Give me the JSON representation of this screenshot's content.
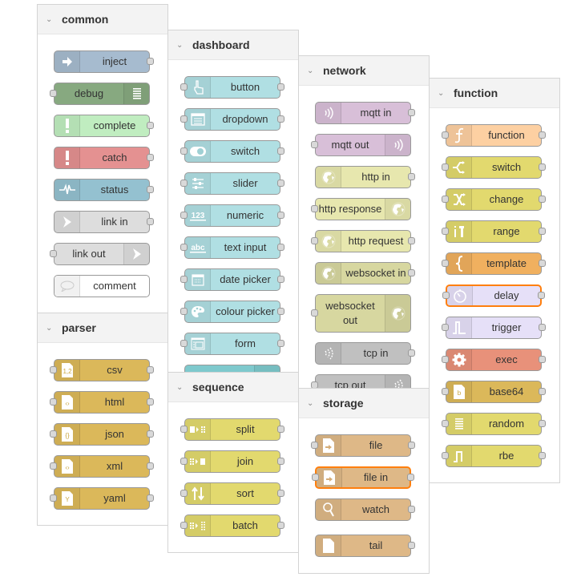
{
  "panels": [
    {
      "title": "common",
      "nodes": [
        {
          "label": "inject",
          "icon": "arrow-in-icon",
          "color": "#a6bbcf",
          "in": false,
          "out": true
        },
        {
          "label": "debug",
          "icon": "list-icon",
          "color": "#87a980",
          "in": true,
          "out": false,
          "icon_right": true
        },
        {
          "label": "complete",
          "icon": "exclamation-icon",
          "color": "#c0edc0",
          "in": false,
          "out": true
        },
        {
          "label": "catch",
          "icon": "exclamation-icon",
          "color": "#e49191",
          "in": false,
          "out": true
        },
        {
          "label": "status",
          "icon": "pulse-icon",
          "color": "#94c1d0",
          "in": false,
          "out": true
        },
        {
          "label": "link in",
          "icon": "link-icon",
          "color": "#dddddd",
          "in": false,
          "out": true
        },
        {
          "label": "link out",
          "icon": "link-icon",
          "color": "#dddddd",
          "in": true,
          "out": false,
          "icon_right": true
        },
        {
          "label": "comment",
          "icon": "speech-bubble-icon",
          "color": "#ffffff",
          "in": false,
          "out": false
        }
      ]
    },
    {
      "title": "parser",
      "nodes": [
        {
          "label": "csv",
          "icon": "csv-file-icon",
          "color": "#dbb85a",
          "in": true,
          "out": true
        },
        {
          "label": "html",
          "icon": "code-file-icon",
          "color": "#dbb85a",
          "in": true,
          "out": true
        },
        {
          "label": "json",
          "icon": "braces-file-icon",
          "color": "#dbb85a",
          "in": true,
          "out": true
        },
        {
          "label": "xml",
          "icon": "code-file-icon",
          "color": "#dbb85a",
          "in": true,
          "out": true
        },
        {
          "label": "yaml",
          "icon": "yaml-file-icon",
          "color": "#dbb85a",
          "in": true,
          "out": true
        }
      ]
    },
    {
      "title": "dashboard",
      "nodes": [
        {
          "label": "button",
          "icon": "hand-pointer-icon",
          "color": "#b0dfe3",
          "in": true,
          "out": true
        },
        {
          "label": "dropdown",
          "icon": "dropdown-list-icon",
          "color": "#b0dfe3",
          "in": true,
          "out": true
        },
        {
          "label": "switch",
          "icon": "toggle-icon",
          "color": "#b0dfe3",
          "in": true,
          "out": true
        },
        {
          "label": "slider",
          "icon": "sliders-icon",
          "color": "#b0dfe3",
          "in": true,
          "out": true
        },
        {
          "label": "numeric",
          "icon": "numeric-123-icon",
          "color": "#b0dfe3",
          "in": true,
          "out": true
        },
        {
          "label": "text input",
          "icon": "text-abc-icon",
          "color": "#b0dfe3",
          "in": true,
          "out": true
        },
        {
          "label": "date picker",
          "icon": "calendar-icon",
          "color": "#b0dfe3",
          "in": true,
          "out": true
        },
        {
          "label": "colour picker",
          "icon": "palette-icon",
          "color": "#b0dfe3",
          "in": true,
          "out": true
        },
        {
          "label": "form",
          "icon": "form-icon",
          "color": "#b0dfe3",
          "in": true,
          "out": true
        },
        {
          "label": "",
          "icon": "",
          "color": "#7ec9cd",
          "in": false,
          "out": false,
          "partial": true
        }
      ]
    },
    {
      "title": "sequence",
      "nodes": [
        {
          "label": "split",
          "icon": "split-icon",
          "color": "#e2d96e",
          "in": true,
          "out": true
        },
        {
          "label": "join",
          "icon": "join-icon",
          "color": "#e2d96e",
          "in": true,
          "out": true
        },
        {
          "label": "sort",
          "icon": "sort-arrows-icon",
          "color": "#e2d96e",
          "in": true,
          "out": true
        },
        {
          "label": "batch",
          "icon": "batch-icon",
          "color": "#e2d96e",
          "in": true,
          "out": true
        }
      ]
    },
    {
      "title": "network",
      "nodes": [
        {
          "label": "mqtt in",
          "icon": "bridge-wave-icon",
          "color": "#d8bfd8",
          "in": false,
          "out": true
        },
        {
          "label": "mqtt out",
          "icon": "bridge-wave-icon",
          "color": "#d8bfd8",
          "in": true,
          "out": false,
          "icon_right": true
        },
        {
          "label": "http in",
          "icon": "globe-icon",
          "color": "#e7e7ae",
          "in": false,
          "out": true
        },
        {
          "label": "http response",
          "icon": "globe-icon",
          "color": "#e7e7ae",
          "in": true,
          "out": false,
          "icon_right": true
        },
        {
          "label": "http request",
          "icon": "globe-icon",
          "color": "#e7e7ae",
          "in": true,
          "out": true
        },
        {
          "label": "websocket in",
          "icon": "globe-icon",
          "color": "#d7d7a0",
          "in": false,
          "out": true
        },
        {
          "label": "websocket out",
          "icon": "globe-icon",
          "color": "#d7d7a0",
          "in": true,
          "out": false,
          "icon_right": true,
          "tall": true
        },
        {
          "label": "tcp in",
          "icon": "bridge-dash-icon",
          "color": "#c0c0c0",
          "in": false,
          "out": true
        },
        {
          "label": "tcp out",
          "icon": "bridge-dash-icon",
          "color": "#c0c0c0",
          "in": true,
          "out": false,
          "icon_right": true
        }
      ]
    },
    {
      "title": "storage",
      "nodes": [
        {
          "label": "file",
          "icon": "file-out-icon",
          "color": "#deb887",
          "in": true,
          "out": true
        },
        {
          "label": "file in",
          "icon": "file-in-icon",
          "color": "#deb887",
          "in": true,
          "out": true,
          "selected": true
        },
        {
          "label": "watch",
          "icon": "magnifier-icon",
          "color": "#deb887",
          "in": false,
          "out": true
        },
        {
          "label": "tail",
          "icon": "file-icon",
          "color": "#deb887",
          "in": false,
          "out": true
        }
      ]
    },
    {
      "title": "function",
      "nodes": [
        {
          "label": "function",
          "icon": "function-f-icon",
          "color": "#fdd0a2",
          "in": true,
          "out": true
        },
        {
          "label": "switch",
          "icon": "switch-branch-icon",
          "color": "#e2d96e",
          "in": true,
          "out": true
        },
        {
          "label": "change",
          "icon": "shuffle-icon",
          "color": "#e2d96e",
          "in": true,
          "out": true
        },
        {
          "label": "range",
          "icon": "range-icon",
          "color": "#e2d96e",
          "in": true,
          "out": true
        },
        {
          "label": "template",
          "icon": "brace-icon",
          "color": "#f0b05f",
          "in": true,
          "out": true
        },
        {
          "label": "delay",
          "icon": "timer-icon",
          "color": "#e6e0f8",
          "in": true,
          "out": true,
          "selected": true
        },
        {
          "label": "trigger",
          "icon": "trigger-pulse-icon",
          "color": "#e6e0f8",
          "in": true,
          "out": true
        },
        {
          "label": "exec",
          "icon": "cog-icon",
          "color": "#e8917a",
          "in": true,
          "out": true
        },
        {
          "label": "base64",
          "icon": "base64-file-icon",
          "color": "#dbb85a",
          "in": true,
          "out": true
        },
        {
          "label": "random",
          "icon": "random-list-icon",
          "color": "#e2d96e",
          "in": true,
          "out": true
        },
        {
          "label": "rbe",
          "icon": "rbe-icon",
          "color": "#e2d96e",
          "in": true,
          "out": true
        }
      ]
    }
  ]
}
